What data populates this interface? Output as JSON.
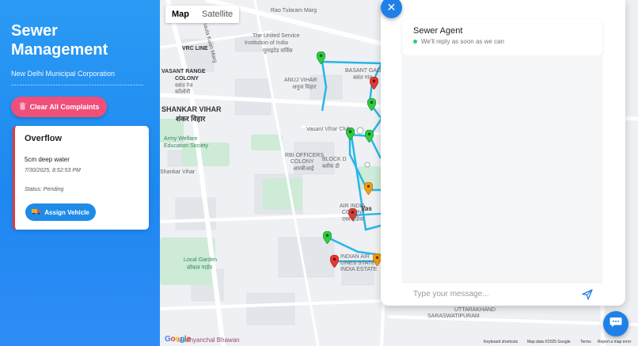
{
  "sidebar": {
    "title": "Sewer Management",
    "org": "New Delhi Municipal Corporation",
    "divider": "------------------------------------------------",
    "clear_button": "Clear All Complaints",
    "complaint": {
      "title": "Overflow",
      "description": "5cm deep water",
      "timestamp": "7/30/2025, 8:52:53 PM",
      "status": "Status: Pending",
      "assign_button": "Assign Vehicle"
    }
  },
  "map": {
    "tabs": [
      "Map",
      "Satellite"
    ],
    "labels": {
      "rao_tularam": "Rao Tularam Marg",
      "vrc_line": "VRC LINE",
      "united_service": "The United Service",
      "institution": "Institution of India",
      "institution_hi": "यूनाइटेड सर्विस",
      "vasant_range": "VASANT RANGE",
      "colony": "COLONY",
      "vasant_range_hi": "वसंत रेंज",
      "colony_hi": "कॉलोनी",
      "anuj_vihar": "ANUJ VIHAR",
      "anuj_vihar_hi": "अनुज विहार",
      "basant_gaon": "BASANT GAON",
      "basant_gaon_hi": "बसंत गांव",
      "shankar_vihar": "SHANKAR VIHAR",
      "shankar_vihar_hi": "शंकर विहार",
      "vasant_vihar_club": "Vasant Vihar Club",
      "army_welfare": "Army Welfare",
      "education_society": "Education Society",
      "rbi_officers": "RBI OFFICERS",
      "rbi_colony": "COLONY",
      "rbi_hi": "आरबीआई",
      "block_d": "BLOCK D",
      "block_d_hi": "ब्लॉक डी",
      "shankar_vihar_2": "Shankar Vihar",
      "air_india": "AIR INDIA",
      "air_india_colony": "COLONY",
      "air_india_hi": "एयर इंडिया",
      "local_garden": "Local Garden",
      "local_garden_hi": "लोकल गार्डन",
      "indian_air_lines": "INDIAN AIR",
      "lines_state": "LINES STATE",
      "india_estate": "INDIA ESTATE",
      "uttarakhand": "UTTARAKHAND",
      "saraswatipuram": "SARASWATIPURAM",
      "madhyanchal": "Madhyanchal Bhawan",
      "dhaula_marg": "Dhaula Kuan Marg",
      "vas": "Vas"
    },
    "footer": {
      "google": "Google",
      "shortcuts": "Keyboard shortcuts",
      "map_data": "Map data ©2025 Google",
      "terms": "Terms",
      "report": "Report a map error"
    }
  },
  "chat": {
    "agent_name": "Sewer Agent",
    "agent_status": "We'll reply as soon as we can",
    "input_placeholder": "Type your message..."
  },
  "colors": {
    "accent": "#1f80e8",
    "danger": "#ef4f7a",
    "route": "#29b6e8",
    "pin_green": "#2ecc40",
    "pin_red": "#e53935",
    "pin_orange": "#f39c12"
  }
}
